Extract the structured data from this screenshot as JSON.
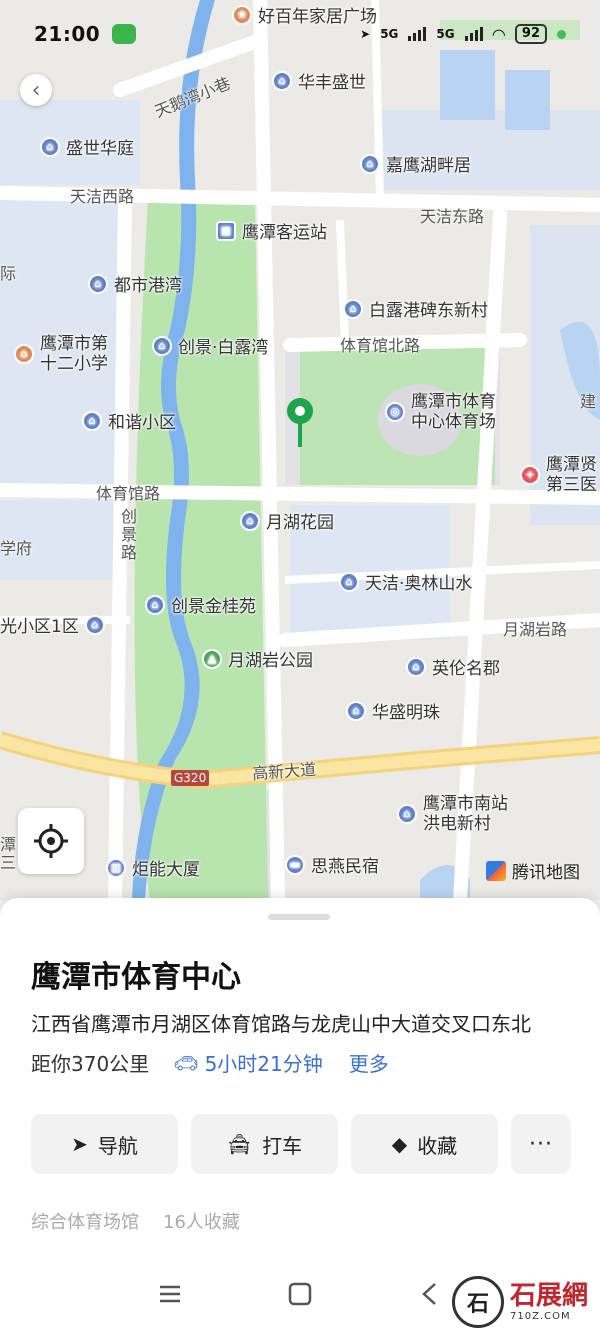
{
  "status_bar": {
    "time": "21:00",
    "network_1": "5G",
    "network_2": "5G",
    "battery": "92"
  },
  "map": {
    "pois": [
      {
        "name": "好百年家居广场",
        "type": "shop"
      },
      {
        "name": "华丰盛世",
        "type": "home"
      },
      {
        "name": "盛世华庭",
        "type": "home"
      },
      {
        "name": "嘉鹰湖畔居",
        "type": "home"
      },
      {
        "name": "鹰潭客运站",
        "type": "bus"
      },
      {
        "name": "都市港湾",
        "type": "home"
      },
      {
        "name": "白露港碑东新村",
        "type": "home"
      },
      {
        "name": "鹰潭市第\n十二小学",
        "type": "school"
      },
      {
        "name": "创景·白露湾",
        "type": "home"
      },
      {
        "name": "鹰潭市体育\n中心体育场",
        "type": "stadium"
      },
      {
        "name": "和谐小区",
        "type": "home"
      },
      {
        "name": "鹰潭贤\n第三医",
        "type": "hospital"
      },
      {
        "name": "月湖花园",
        "type": "home"
      },
      {
        "name": "天洁·奥林山水",
        "type": "home"
      },
      {
        "name": "创景金桂苑",
        "type": "home"
      },
      {
        "name": "光小区1区",
        "type": "home"
      },
      {
        "name": "月湖岩公园",
        "type": "park"
      },
      {
        "name": "英伦名郡",
        "type": "home"
      },
      {
        "name": "华盛明珠",
        "type": "home"
      },
      {
        "name": "鹰潭市南站\n洪电新村",
        "type": "home"
      },
      {
        "name": "炬能大厦",
        "type": "office"
      },
      {
        "name": "思燕民宿",
        "type": "hotel"
      }
    ],
    "roads": [
      "天鹅湾小巷",
      "天洁西路",
      "天洁东路",
      "体育馆北路",
      "体育馆路",
      "创景路",
      "月湖岩路",
      "高新大道",
      "G320"
    ],
    "edge_labels": [
      "际",
      "学府",
      "建",
      "潭",
      "三"
    ],
    "attribution": "腾讯地图"
  },
  "place": {
    "title": "鹰潭市体育中心",
    "address": "江西省鹰潭市月湖区体育馆路与龙虎山中大道交叉口东北",
    "distance": "距你370公里",
    "drive_time": "5小时21分钟",
    "more": "更多",
    "category": "综合体育场馆",
    "favorites": "16人收藏"
  },
  "actions": {
    "navigate": "导航",
    "taxi": "打车",
    "collect": "收藏",
    "more": "···"
  },
  "watermark": {
    "glyph": "石",
    "brand": "石展網",
    "domain": "710Z.COM"
  },
  "colors": {
    "accent": "#3b6fd6",
    "marker": "#1ea54b",
    "park": "#b8e4ae",
    "water": "#b9d4f3"
  }
}
